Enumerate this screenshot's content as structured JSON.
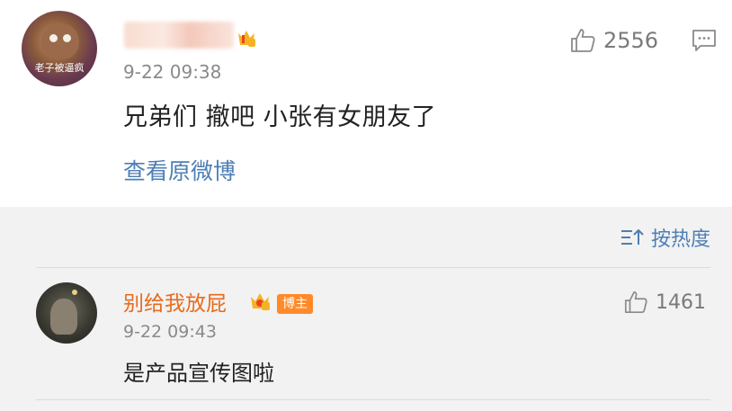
{
  "post": {
    "avatar_caption": "老子被逼疯",
    "timestamp": "9-22 09:38",
    "content": "兄弟们  撤吧  小张有女朋友了",
    "link_text": "查看原微博",
    "like_count": "2556"
  },
  "comments": {
    "sort_label": "按热度",
    "items": [
      {
        "username": "别给我放屁",
        "tag": "博主",
        "timestamp": "9-22 09:43",
        "content": "是产品宣传图啦",
        "like_count": "1461"
      }
    ]
  },
  "colors": {
    "link": "#4d7fb5",
    "username": "#e86b1c",
    "tag_bg": "#ff8a2a",
    "comment_bg": "#f2f2f2"
  }
}
